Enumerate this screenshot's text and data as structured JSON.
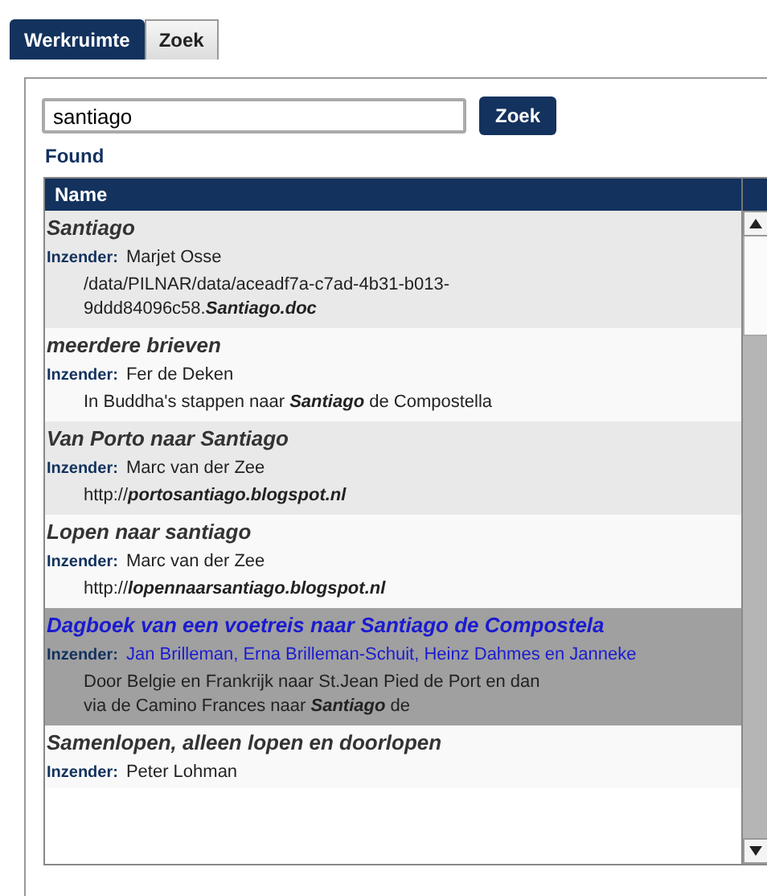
{
  "tabs": [
    {
      "label": "Werkruimte",
      "selected": true
    },
    {
      "label": "Zoek",
      "selected": false
    }
  ],
  "search": {
    "value": "santiago",
    "button": "Zoek"
  },
  "found_label": "Found",
  "table": {
    "columns": [
      "Name"
    ],
    "rows": [
      {
        "title": "Santiago",
        "submitter_label": "Inzender:",
        "submitter": "Marjet Osse",
        "description": "/data/PILNAR/data/aceadf7a-c7ad-4b31-b013-9ddd84096c58.**Santiago.doc**",
        "selected": false
      },
      {
        "title": "meerdere brieven",
        "submitter_label": "Inzender:",
        "submitter": "Fer de Deken",
        "description": "In Buddha's stappen naar **Santiago** de Compostella",
        "selected": false
      },
      {
        "title": "Van Porto naar Santiago",
        "submitter_label": "Inzender:",
        "submitter": "Marc van der Zee",
        "description": "http://**portosantiago.blogspot.nl**",
        "selected": false
      },
      {
        "title": "Lopen naar santiago",
        "submitter_label": "Inzender:",
        "submitter": "Marc van der Zee",
        "description": "http://**lopennaarsantiago.blogspot.nl**",
        "selected": false
      },
      {
        "title": "Dagboek van een voetreis naar Santiago de Compostela",
        "submitter_label": "Inzender:",
        "submitter": "Jan Brilleman, Erna Brilleman-Schuit, Heinz Dahmes en Janneke",
        "description": "Door Belgie en Frankrijk naar St.Jean Pied de Port en dan via de Camino Frances naar **Santiago** de",
        "selected": true
      },
      {
        "title": "Samenlopen, alleen lopen en doorlopen",
        "submitter_label": "Inzender:",
        "submitter": "Peter Lohman",
        "selected": false
      }
    ]
  }
}
